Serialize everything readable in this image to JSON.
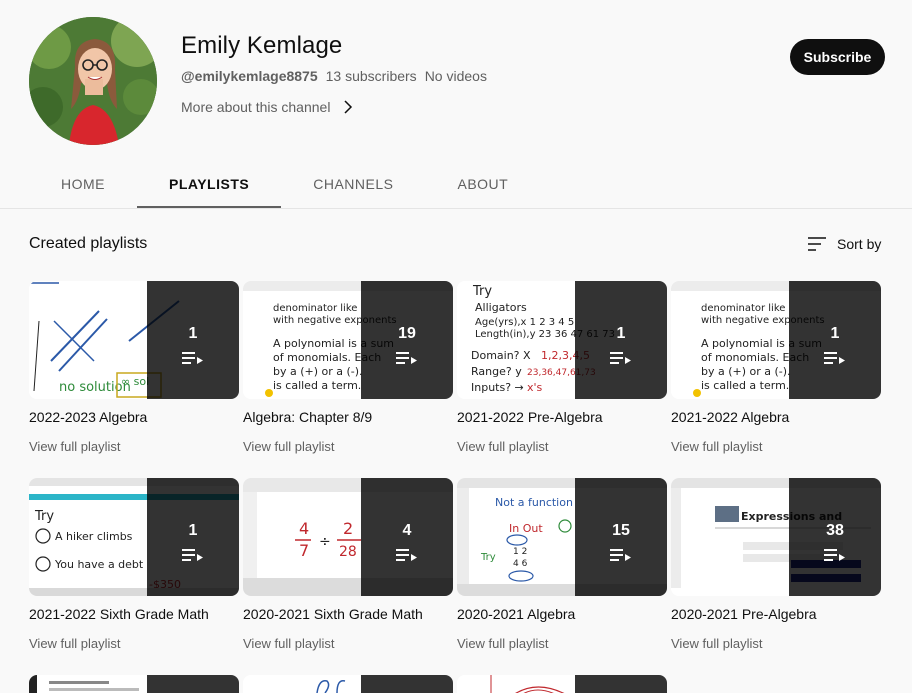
{
  "channel": {
    "name": "Emily Kemlage",
    "handle": "@emilykemlage8875",
    "subscribers": "13 subscribers",
    "videos": "No videos",
    "more_about": "More about this channel",
    "subscribe_label": "Subscribe"
  },
  "tabs": [
    {
      "label": "HOME",
      "active": false
    },
    {
      "label": "PLAYLISTS",
      "active": true
    },
    {
      "label": "CHANNELS",
      "active": false
    },
    {
      "label": "ABOUT",
      "active": false
    }
  ],
  "section": {
    "title": "Created playlists",
    "sort_label": "Sort by"
  },
  "playlists": [
    {
      "title": "2022-2023 Algebra",
      "count": "1",
      "link": "View full playlist"
    },
    {
      "title": "Algebra: Chapter 8/9",
      "count": "19",
      "link": "View full playlist"
    },
    {
      "title": "2021-2022 Pre-Algebra",
      "count": "1",
      "link": "View full playlist"
    },
    {
      "title": "2021-2022 Algebra",
      "count": "1",
      "link": "View full playlist"
    },
    {
      "title": "2021-2022 Sixth Grade Math",
      "count": "1",
      "link": "View full playlist"
    },
    {
      "title": "2020-2021 Sixth Grade Math",
      "count": "4",
      "link": "View full playlist"
    },
    {
      "title": "2020-2021 Algebra",
      "count": "15",
      "link": "View full playlist"
    },
    {
      "title": "2020-2021 Pre-Algebra",
      "count": "38",
      "link": "View full playlist"
    }
  ],
  "icons": {
    "playlist": "playlist-play-icon",
    "sort": "sort-icon",
    "chevron": "chevron-right-icon"
  },
  "colors": {
    "background": "#f9f9f9",
    "subscribe_bg": "#0f0f0f",
    "secondary_text": "#606060"
  }
}
